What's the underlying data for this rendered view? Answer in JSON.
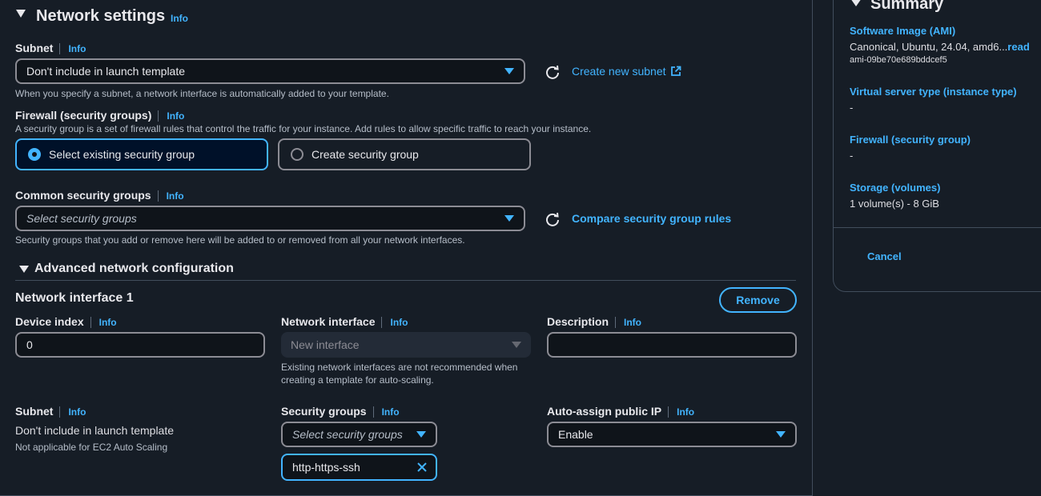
{
  "network": {
    "title": "Network settings",
    "info": "Info",
    "subnet": {
      "label": "Subnet",
      "value": "Don't include in launch template",
      "hint": "When you specify a subnet, a network interface is automatically added to your template.",
      "create_link": "Create new subnet"
    },
    "firewall": {
      "label": "Firewall (security groups)",
      "hint": "A security group is a set of firewall rules that control the traffic for your instance. Add rules to allow specific traffic to reach your instance.",
      "option_existing": "Select existing security group",
      "option_create": "Create security group"
    },
    "common_sg": {
      "label": "Common security groups",
      "placeholder": "Select security groups",
      "hint": "Security groups that you add or remove here will be added to or removed from all your network interfaces.",
      "compare_link": "Compare security group rules"
    },
    "advanced": {
      "title": "Advanced network configuration",
      "interface_title": "Network interface 1",
      "remove_label": "Remove",
      "device_index_label": "Device index",
      "device_index_value": "0",
      "net_iface_label": "Network interface",
      "net_iface_value": "New interface",
      "net_iface_hint_1": "Existing network interfaces are not recommended when",
      "net_iface_hint_2": "creating a template for auto-scaling.",
      "description_label": "Description",
      "description_value": "",
      "subnet_label": "Subnet",
      "subnet_value": "Don't include in launch template",
      "subnet_hint": "Not applicable for EC2 Auto Scaling",
      "sg_label": "Security groups",
      "sg_placeholder": "Select security groups",
      "sg_token": "http-https-ssh",
      "public_ip_label": "Auto-assign public IP",
      "public_ip_value": "Enable"
    }
  },
  "summary": {
    "title": "Summary",
    "ami_label": "Software Image (AMI)",
    "ami_value": "Canonical, Ubuntu, 24.04, amd6...",
    "ami_read_more": "read",
    "ami_id": "ami-09be70e689bddcef5",
    "instance_type_label": "Virtual server type (instance type)",
    "instance_type_value": "-",
    "firewall_label": "Firewall (security group)",
    "firewall_value": "-",
    "storage_label": "Storage (volumes)",
    "storage_value": "1 volume(s) - 8 GiB",
    "cancel_label": "Cancel"
  },
  "colors": {
    "background": "#161d26",
    "accent": "#42b4ff",
    "border": "#8c8c94"
  }
}
